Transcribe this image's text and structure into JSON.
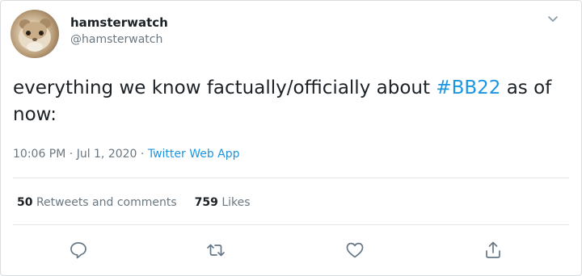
{
  "user": {
    "display_name": "hamsterwatch",
    "handle": "@hamsterwatch"
  },
  "tweet": {
    "text_before": "everything we know factually/officially about ",
    "hashtag": "#BB22",
    "text_after": " as of now:"
  },
  "meta": {
    "time": "10:06 PM",
    "separator": " · ",
    "date": "Jul 1, 2020",
    "app": "Twitter Web App"
  },
  "stats": {
    "retweets_count": "50",
    "retweets_label": "Retweets and comments",
    "likes_count": "759",
    "likes_label": "Likes"
  },
  "icons": {
    "menu": "chevron-down-icon",
    "reply": "reply-icon",
    "retweet": "retweet-icon",
    "like": "heart-icon",
    "share": "share-icon"
  },
  "colors": {
    "link": "#1b95e0",
    "text": "#1c2126",
    "muted": "#6b7780"
  }
}
